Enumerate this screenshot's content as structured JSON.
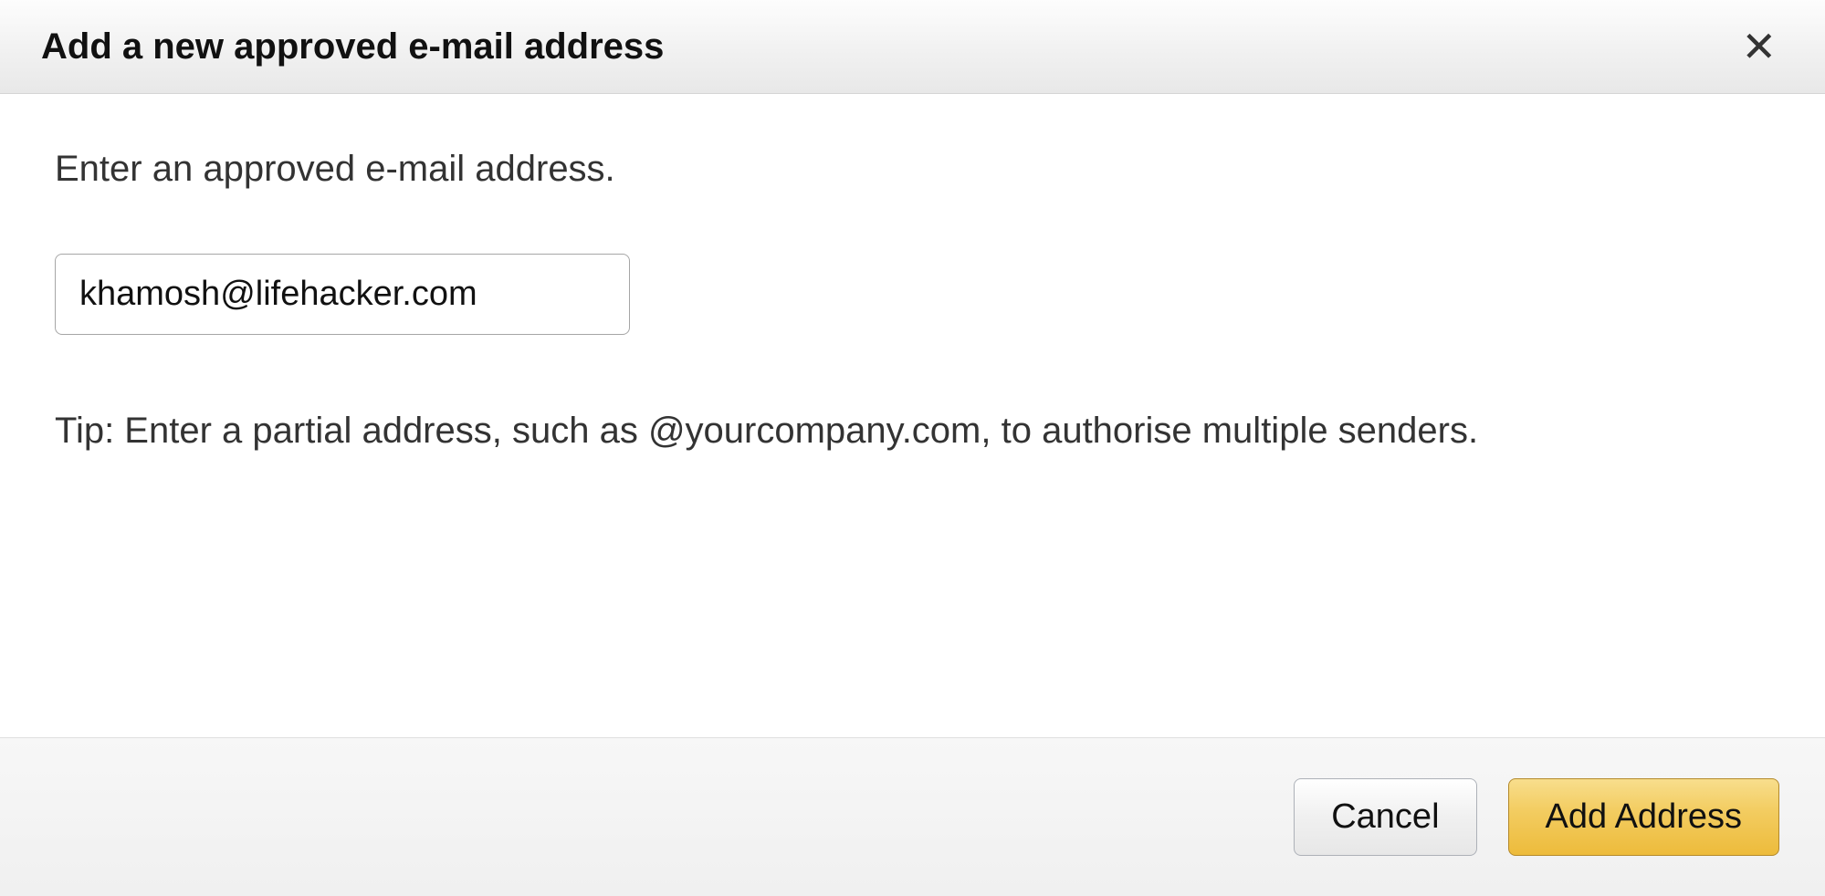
{
  "dialog": {
    "title": "Add a new approved e-mail address",
    "prompt": "Enter an approved e-mail address.",
    "email_value": "khamosh@lifehacker.com",
    "tip": "Tip: Enter a partial address, such as @yourcompany.com, to authorise multiple senders."
  },
  "footer": {
    "cancel_label": "Cancel",
    "add_label": "Add Address"
  }
}
